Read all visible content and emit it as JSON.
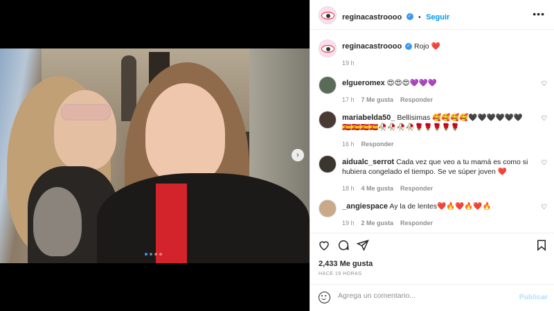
{
  "post": {
    "username": "reginacastroooo",
    "follow_label": "Seguir",
    "more_icon": "more-horizontal-icon",
    "caption_text": "Rojo ❤️",
    "caption_time": "19 h"
  },
  "comments": [
    {
      "username": "elgueromex",
      "text": "😍😍😍💜💜💜",
      "time": "17 h",
      "likes": "7 Me gusta",
      "reply": "Responder",
      "avatar_color": "#5a6b5a"
    },
    {
      "username": "mariabelda50_",
      "text": "Bellísimas 🥰🥰🥰🥰🖤🖤🖤🖤🖤🖤🇪🇸🇪🇸🇪🇸🇪🇸🥀🥀🥀🥀🌹🌹🌹🌹🌹",
      "time": "16 h",
      "likes": "",
      "reply": "Responder",
      "avatar_color": "#4a3a36"
    },
    {
      "username": "aidualc_serrot",
      "text": "Cada vez que veo a tu mamá es como si hubiera congelado el tiempo. Se ve súper joven ❤️",
      "time": "18 h",
      "likes": "4 Me gusta",
      "reply": "Responder",
      "avatar_color": "#3b3530"
    },
    {
      "username": "_angiespace",
      "text": "Ay la de lentes❤️🔥❤️🔥❤️🔥",
      "time": "19 h",
      "likes": "2 Me gusta",
      "reply": "Responder",
      "avatar_color": "#c9a98a"
    }
  ],
  "actions": {
    "likes": "2,433 Me gusta",
    "time_ago": "HACE 19 HORAS"
  },
  "comment_box": {
    "placeholder": "Agrega un comentario...",
    "publish_label": "Publicar"
  },
  "carousel": {
    "total": 4,
    "active_index": 0
  }
}
